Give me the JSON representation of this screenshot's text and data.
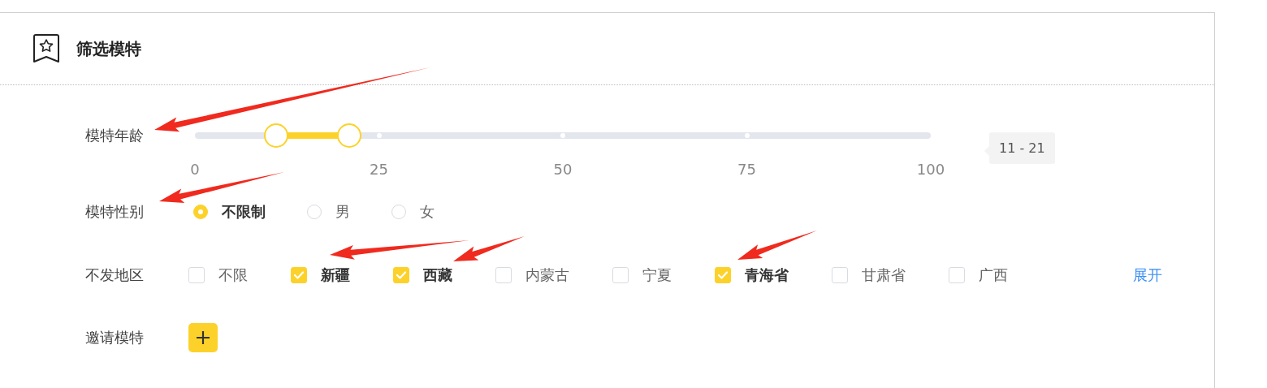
{
  "panel": {
    "title": "筛选模特"
  },
  "age": {
    "label": "模特年龄",
    "ticks": [
      "0",
      "25",
      "50",
      "75",
      "100"
    ],
    "low": {
      "level": 0.11
    },
    "high": {
      "level": 0.21
    },
    "tooltip": "11 - 21"
  },
  "gender": {
    "label": "模特性别",
    "options": [
      {
        "label": "不限制",
        "selected": true
      },
      {
        "label": "男",
        "selected": false
      },
      {
        "label": "女",
        "selected": false
      }
    ]
  },
  "regions": {
    "label": "不发地区",
    "options": [
      {
        "label": "不限",
        "checked": false
      },
      {
        "label": "新疆",
        "checked": true
      },
      {
        "label": "西藏",
        "checked": true
      },
      {
        "label": "内蒙古",
        "checked": false
      },
      {
        "label": "宁夏",
        "checked": false
      },
      {
        "label": "青海省",
        "checked": true
      },
      {
        "label": "甘肃省",
        "checked": false
      },
      {
        "label": "广西",
        "checked": false
      }
    ],
    "expand": "展开"
  },
  "invite": {
    "label": "邀请模特"
  }
}
